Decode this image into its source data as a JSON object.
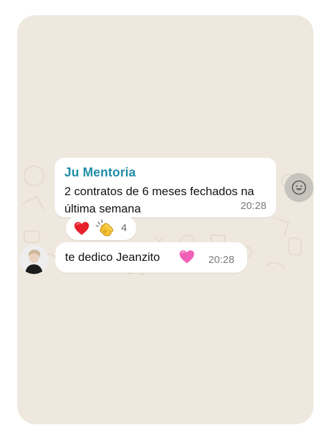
{
  "chat": {
    "messages": [
      {
        "sender": "Ju Mentoria",
        "text": "2 contratos de 6 meses fechados na última semana",
        "time": "20:28",
        "reactions": {
          "emojis": [
            "red-heart",
            "clapping-hands"
          ],
          "count": "4"
        }
      },
      {
        "text": "te dedico Jeanzito",
        "emoji": "pink-heart",
        "time": "20:28"
      }
    ],
    "actions": {
      "react_button_icon": "smiley-icon"
    }
  },
  "colors": {
    "background": "#efe8de",
    "bubble": "#ffffff",
    "sender_name": "#1f8da6",
    "time_text": "#7b7b7b"
  }
}
